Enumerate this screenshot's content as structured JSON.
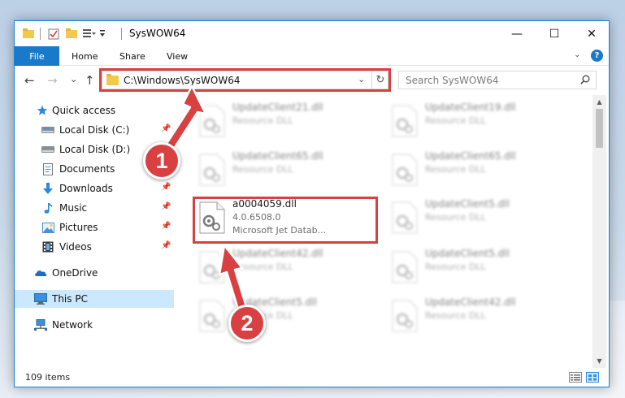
{
  "window": {
    "title": "SysWOW64",
    "minimize_glyph": "—",
    "maximize_glyph": "☐",
    "close_glyph": "✕"
  },
  "ribbon": {
    "tabs": [
      {
        "label": "File"
      },
      {
        "label": "Home"
      },
      {
        "label": "Share"
      },
      {
        "label": "View"
      }
    ],
    "expand_glyph": "⌄",
    "help_label": "?"
  },
  "navbar": {
    "back_glyph": "←",
    "forward_glyph": "→",
    "recent_glyph": "⌄",
    "up_glyph": "↑",
    "address": "C:\\Windows\\SysWOW64",
    "address_dropdown_glyph": "⌄",
    "refresh_glyph": "↻",
    "search_placeholder": "Search SysWOW64"
  },
  "sidebar": {
    "items": [
      {
        "label": "Quick access",
        "icon": "star-icon"
      },
      {
        "label": "Local Disk (C:)",
        "icon": "drive-icon",
        "pinned": true
      },
      {
        "label": "Local Disk (D:)",
        "icon": "drive-icon"
      },
      {
        "label": "Documents",
        "icon": "documents-icon"
      },
      {
        "label": "Downloads",
        "icon": "downloads-icon",
        "pinned": true
      },
      {
        "label": "Music",
        "icon": "music-icon",
        "pinned": true
      },
      {
        "label": "Pictures",
        "icon": "pictures-icon",
        "pinned": true
      },
      {
        "label": "Videos",
        "icon": "videos-icon",
        "pinned": true
      },
      {
        "label": "OneDrive",
        "icon": "onedrive-icon"
      },
      {
        "label": "This PC",
        "icon": "computer-icon",
        "selected": true
      },
      {
        "label": "Network",
        "icon": "network-icon"
      }
    ],
    "pin_glyph": "📌"
  },
  "files": [
    {
      "name": "UpdateClient21.dll",
      "desc": "Resource DLL",
      "blurred": true
    },
    {
      "name": "UpdateClient19.dll",
      "desc": "Resource DLL",
      "blurred": true
    },
    {
      "name": "UpdateClient65.dll",
      "desc": "Resource DLL",
      "blurred": true
    },
    {
      "name": "UpdateClient65.dll",
      "desc": "Resource DLL",
      "blurred": true
    },
    {
      "name": "a0004059.dll",
      "version": "4.0.6508.0",
      "desc": "Microsoft Jet Datab...",
      "blurred": false
    },
    {
      "name": "UpdateClient5.dll",
      "desc": "Resource DLL",
      "blurred": true
    },
    {
      "name": "UpdateClient42.dll",
      "desc": "Resource DLL",
      "blurred": true
    },
    {
      "name": "UpdateClient5.dll",
      "desc": "Resource DLL",
      "blurred": true
    },
    {
      "name": "UpdateClient5.dll",
      "desc": "Resource DLL",
      "blurred": true
    },
    {
      "name": "UpdateClient42.dll",
      "desc": "Resource DLL",
      "blurred": true
    }
  ],
  "scrollbar": {
    "up_glyph": "▲",
    "down_glyph": "▼"
  },
  "status": {
    "item_count": "109 items"
  },
  "annotations": {
    "step1": "1",
    "step2": "2",
    "color": "#d84042"
  },
  "colors": {
    "accent": "#1979ca",
    "selection": "#cce8ff",
    "highlight": "#d84042"
  }
}
